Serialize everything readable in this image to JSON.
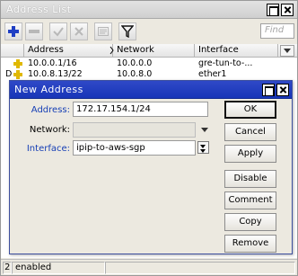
{
  "window": {
    "title": "Address List"
  },
  "toolbar": {
    "find_placeholder": "Find"
  },
  "table": {
    "columns": [
      "Address",
      "Network",
      "Interface"
    ],
    "rows": [
      {
        "flag": "",
        "address": "10.0.0.1/16",
        "network": "10.0.0.0",
        "interface": "gre-tun-to-..."
      },
      {
        "flag": "D",
        "address": "10.0.8.13/22",
        "network": "10.0.8.0",
        "interface": "ether1"
      }
    ]
  },
  "dialog": {
    "title": "New Address",
    "address_label": "Address:",
    "address_value": "172.17.154.1/24",
    "network_label": "Network:",
    "network_value": "",
    "interface_label": "Interface:",
    "interface_value": "ipip-to-aws-sgp",
    "buttons": {
      "ok": "OK",
      "cancel": "Cancel",
      "apply": "Apply",
      "disable": "Disable",
      "comment": "Comment",
      "copy": "Copy",
      "remove": "Remove"
    }
  },
  "dialog_status": {
    "cell": "2"
  },
  "status": {
    "text": "enabled"
  },
  "colors": {
    "accent": "#1836b8",
    "add_icon": "#1f3fc4",
    "address_icon": "#e0b800"
  }
}
